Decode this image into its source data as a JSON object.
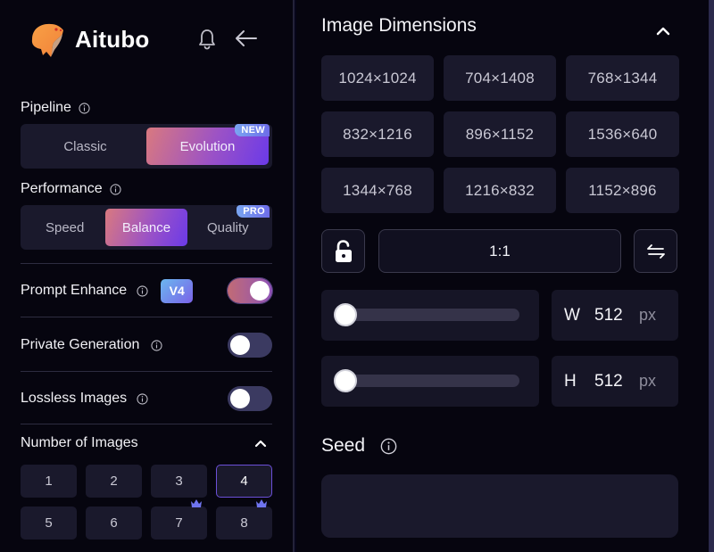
{
  "brand": {
    "name": "Aitubo",
    "logo_icon": "otter-logo-icon"
  },
  "header": {
    "notifications_icon": "bell-icon",
    "back_icon": "arrow-left-icon"
  },
  "sidebar": {
    "pipeline": {
      "label": "Pipeline",
      "options": [
        {
          "label": "Classic",
          "active": false
        },
        {
          "label": "Evolution",
          "active": true,
          "badge": "NEW"
        }
      ]
    },
    "performance": {
      "label": "Performance",
      "options": [
        {
          "label": "Speed",
          "active": false
        },
        {
          "label": "Balance",
          "active": true
        },
        {
          "label": "Quality",
          "active": false,
          "badge": "PRO"
        }
      ]
    },
    "prompt_enhance": {
      "label": "Prompt Enhance",
      "version_badge": "V4",
      "enabled": true
    },
    "private_generation": {
      "label": "Private Generation",
      "enabled": false
    },
    "lossless_images": {
      "label": "Lossless Images",
      "enabled": false
    },
    "number_of_images": {
      "label": "Number of Images",
      "options": [
        {
          "label": "1",
          "premium": false
        },
        {
          "label": "2",
          "premium": false
        },
        {
          "label": "3",
          "premium": false
        },
        {
          "label": "4",
          "premium": false,
          "selected": true
        },
        {
          "label": "5",
          "premium": false
        },
        {
          "label": "6",
          "premium": false
        },
        {
          "label": "7",
          "premium": true
        },
        {
          "label": "8",
          "premium": true
        }
      ]
    }
  },
  "main": {
    "image_dimensions": {
      "title": "Image Dimensions",
      "presets": [
        "1024×1024",
        "704×1408",
        "768×1344",
        "832×1216",
        "896×1152",
        "1536×640",
        "1344×768",
        "1216×832",
        "1152×896"
      ],
      "ratio": "1:1",
      "lock_icon": "unlock-icon",
      "swap_icon": "swap-arrows-icon",
      "width": {
        "axis": "W",
        "value": "512",
        "unit": "px",
        "slider_fraction": 0.0
      },
      "height": {
        "axis": "H",
        "value": "512",
        "unit": "px",
        "slider_fraction": 0.0
      }
    },
    "seed": {
      "title": "Seed",
      "value": "",
      "placeholder": ""
    }
  },
  "colors": {
    "background": "#06050f",
    "surface": "#1a192c",
    "accent_gradient_start": "#d9797f",
    "accent_gradient_end": "#6b3ae8",
    "selected_border": "#6b4fd8",
    "toggle_off": "#3b3a61"
  }
}
